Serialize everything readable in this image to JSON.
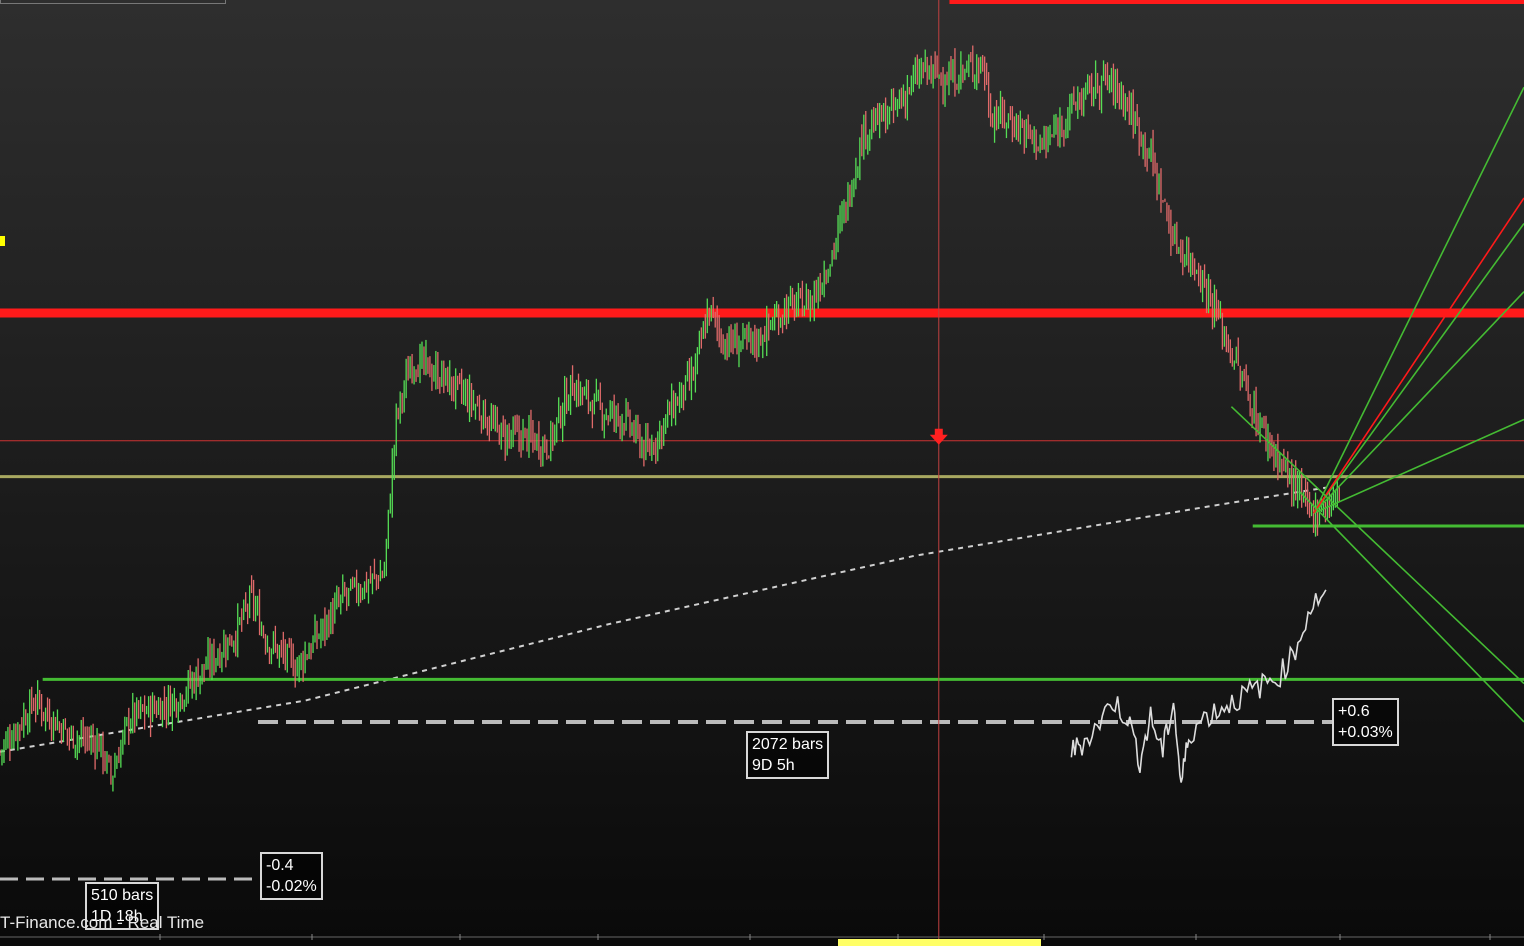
{
  "watermark": "T-Finance.com - Real Time",
  "colors": {
    "background": "#1c1c1c",
    "up": "#55dd55",
    "down": "#e06a6a",
    "resistance": "#ff1a1a",
    "support": "#44bb33",
    "measure": "#d8d8d8"
  },
  "measures": [
    {
      "id": "left",
      "bars": "510 bars",
      "duration": "1D 18h",
      "change": "-0.4",
      "percent": "-0.02%"
    },
    {
      "id": "right",
      "bars": "2072 bars",
      "duration": "9D 5h",
      "change": "+0.6",
      "percent": "+0.03%"
    }
  ],
  "chart_data": {
    "type": "candlestick",
    "title": "",
    "xlabel": "",
    "ylabel": "",
    "grid": false,
    "legend": "none",
    "note_scale": "relative price units 0 (bottom) to 100 (top); axis not printed",
    "ylim": [
      0,
      100
    ],
    "xlim": [
      0,
      100
    ],
    "price_path": [
      [
        0,
        12
      ],
      [
        2.3,
        18
      ],
      [
        4.5,
        14
      ],
      [
        6.5,
        13
      ],
      [
        7.3,
        9
      ],
      [
        8.5,
        16
      ],
      [
        11.5,
        18
      ],
      [
        13.5,
        22
      ],
      [
        15.5,
        26
      ],
      [
        16.5,
        30
      ],
      [
        17.5,
        25
      ],
      [
        19.5,
        22
      ],
      [
        22.5,
        30
      ],
      [
        25.2,
        33
      ],
      [
        26,
        51
      ],
      [
        27,
        58
      ],
      [
        29,
        56
      ],
      [
        31,
        53
      ],
      [
        33,
        49
      ],
      [
        34.5,
        49
      ],
      [
        36,
        48
      ],
      [
        37.5,
        55
      ],
      [
        39.5,
        52
      ],
      [
        41,
        51
      ],
      [
        42.5,
        47
      ],
      [
        44,
        52
      ],
      [
        45.5,
        56
      ],
      [
        46.5,
        64
      ],
      [
        47.5,
        60
      ],
      [
        49.5,
        60
      ],
      [
        51.5,
        64
      ],
      [
        53.3,
        65
      ],
      [
        54.5,
        70
      ],
      [
        55.5,
        76
      ],
      [
        56.7,
        85
      ],
      [
        58.5,
        87
      ],
      [
        60.5,
        92
      ],
      [
        62.3,
        91
      ],
      [
        64.5,
        93
      ],
      [
        65,
        87
      ],
      [
        66.5,
        86
      ],
      [
        68.5,
        83
      ],
      [
        70.5,
        88
      ],
      [
        72.5,
        91
      ],
      [
        73.7,
        89
      ],
      [
        75.5,
        82
      ],
      [
        77,
        72
      ],
      [
        78.5,
        69
      ],
      [
        79.5,
        65
      ],
      [
        81,
        58
      ],
      [
        82.5,
        51
      ],
      [
        84,
        46
      ],
      [
        85,
        43
      ],
      [
        86,
        40
      ],
      [
        86.9,
        41
      ],
      [
        88,
        42
      ]
    ],
    "horizontal_lines": [
      {
        "name": "resistance-top",
        "y": 100,
        "x_start": 62.3,
        "color": "#ff1a1a"
      },
      {
        "name": "resistance-main",
        "y": 63.5,
        "x_start": 0,
        "color": "#ff1a1a"
      },
      {
        "name": "resistance-thin",
        "y": 48.5,
        "x_start": 0,
        "color": "#cc3333"
      },
      {
        "name": "support-olive",
        "y": 44.3,
        "x_start": 0,
        "color": "#a8a860"
      },
      {
        "name": "support-right",
        "y": 38.5,
        "x_start": 82.2,
        "color": "#44bb33"
      },
      {
        "name": "support-low",
        "y": 20.5,
        "x_start": 2.8,
        "color": "#44bb33"
      }
    ],
    "vertical_line_x": 61.6,
    "moving_average": [
      [
        0,
        12
      ],
      [
        20,
        18
      ],
      [
        40,
        27
      ],
      [
        60,
        35
      ],
      [
        80,
        41
      ],
      [
        87,
        43
      ]
    ],
    "fan_origin": [
      86.2,
      40
    ],
    "fan_lines": [
      {
        "to": [
          100,
          90
        ],
        "color": "#44bb33"
      },
      {
        "to": [
          100,
          74
        ],
        "color": "#44bb33"
      },
      {
        "to": [
          100,
          66
        ],
        "color": "#44bb33"
      },
      {
        "to": [
          100,
          51
        ],
        "color": "#44bb33"
      },
      {
        "to": [
          100,
          77
        ],
        "color": "#ff1a1a"
      }
    ],
    "down_channel": [
      {
        "from": [
          80.8,
          52.5
        ],
        "to": [
          100,
          20
        ]
      },
      {
        "from": [
          85.3,
          42.5
        ],
        "to": [
          100,
          15.5
        ]
      }
    ],
    "oscillator": [
      [
        70.3,
        12
      ],
      [
        71,
        13
      ],
      [
        72,
        15
      ],
      [
        73,
        18
      ],
      [
        74,
        16
      ],
      [
        74.8,
        11
      ],
      [
        75.5,
        16
      ],
      [
        76.3,
        12
      ],
      [
        77,
        18
      ],
      [
        77.5,
        8
      ],
      [
        78,
        14
      ],
      [
        79,
        16
      ],
      [
        80,
        17
      ],
      [
        81,
        18
      ],
      [
        82,
        19
      ],
      [
        83,
        20
      ],
      [
        84,
        21
      ],
      [
        85,
        24
      ],
      [
        86,
        29
      ],
      [
        87,
        31
      ]
    ]
  }
}
